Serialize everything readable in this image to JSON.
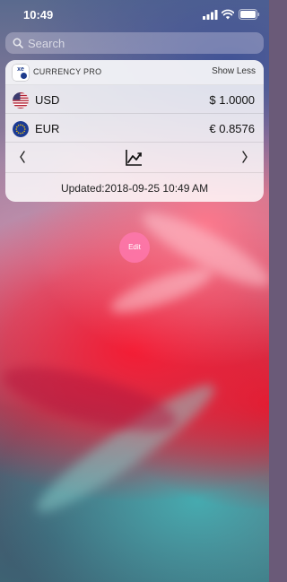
{
  "status_bar": {
    "time": "10:49"
  },
  "search": {
    "placeholder": "Search"
  },
  "widget": {
    "app_name": "CURRENCY PRO",
    "show_less_label": "Show Less",
    "rows": [
      {
        "flag": "us-flag-icon",
        "code": "USD",
        "rate": "$ 1.0000"
      },
      {
        "flag": "eu-flag-icon",
        "code": "EUR",
        "rate": "€ 0.8576"
      }
    ],
    "prev_icon": "⟨",
    "next_icon": "⟩",
    "updated_text": "Updated:2018-09-25 10:49 AM"
  },
  "edit_button": {
    "label": "Edit"
  },
  "colors": {
    "edit_button": "#ff78af",
    "wallpaper_red": "#f41c34",
    "wallpaper_teal": "#46aaaf"
  }
}
